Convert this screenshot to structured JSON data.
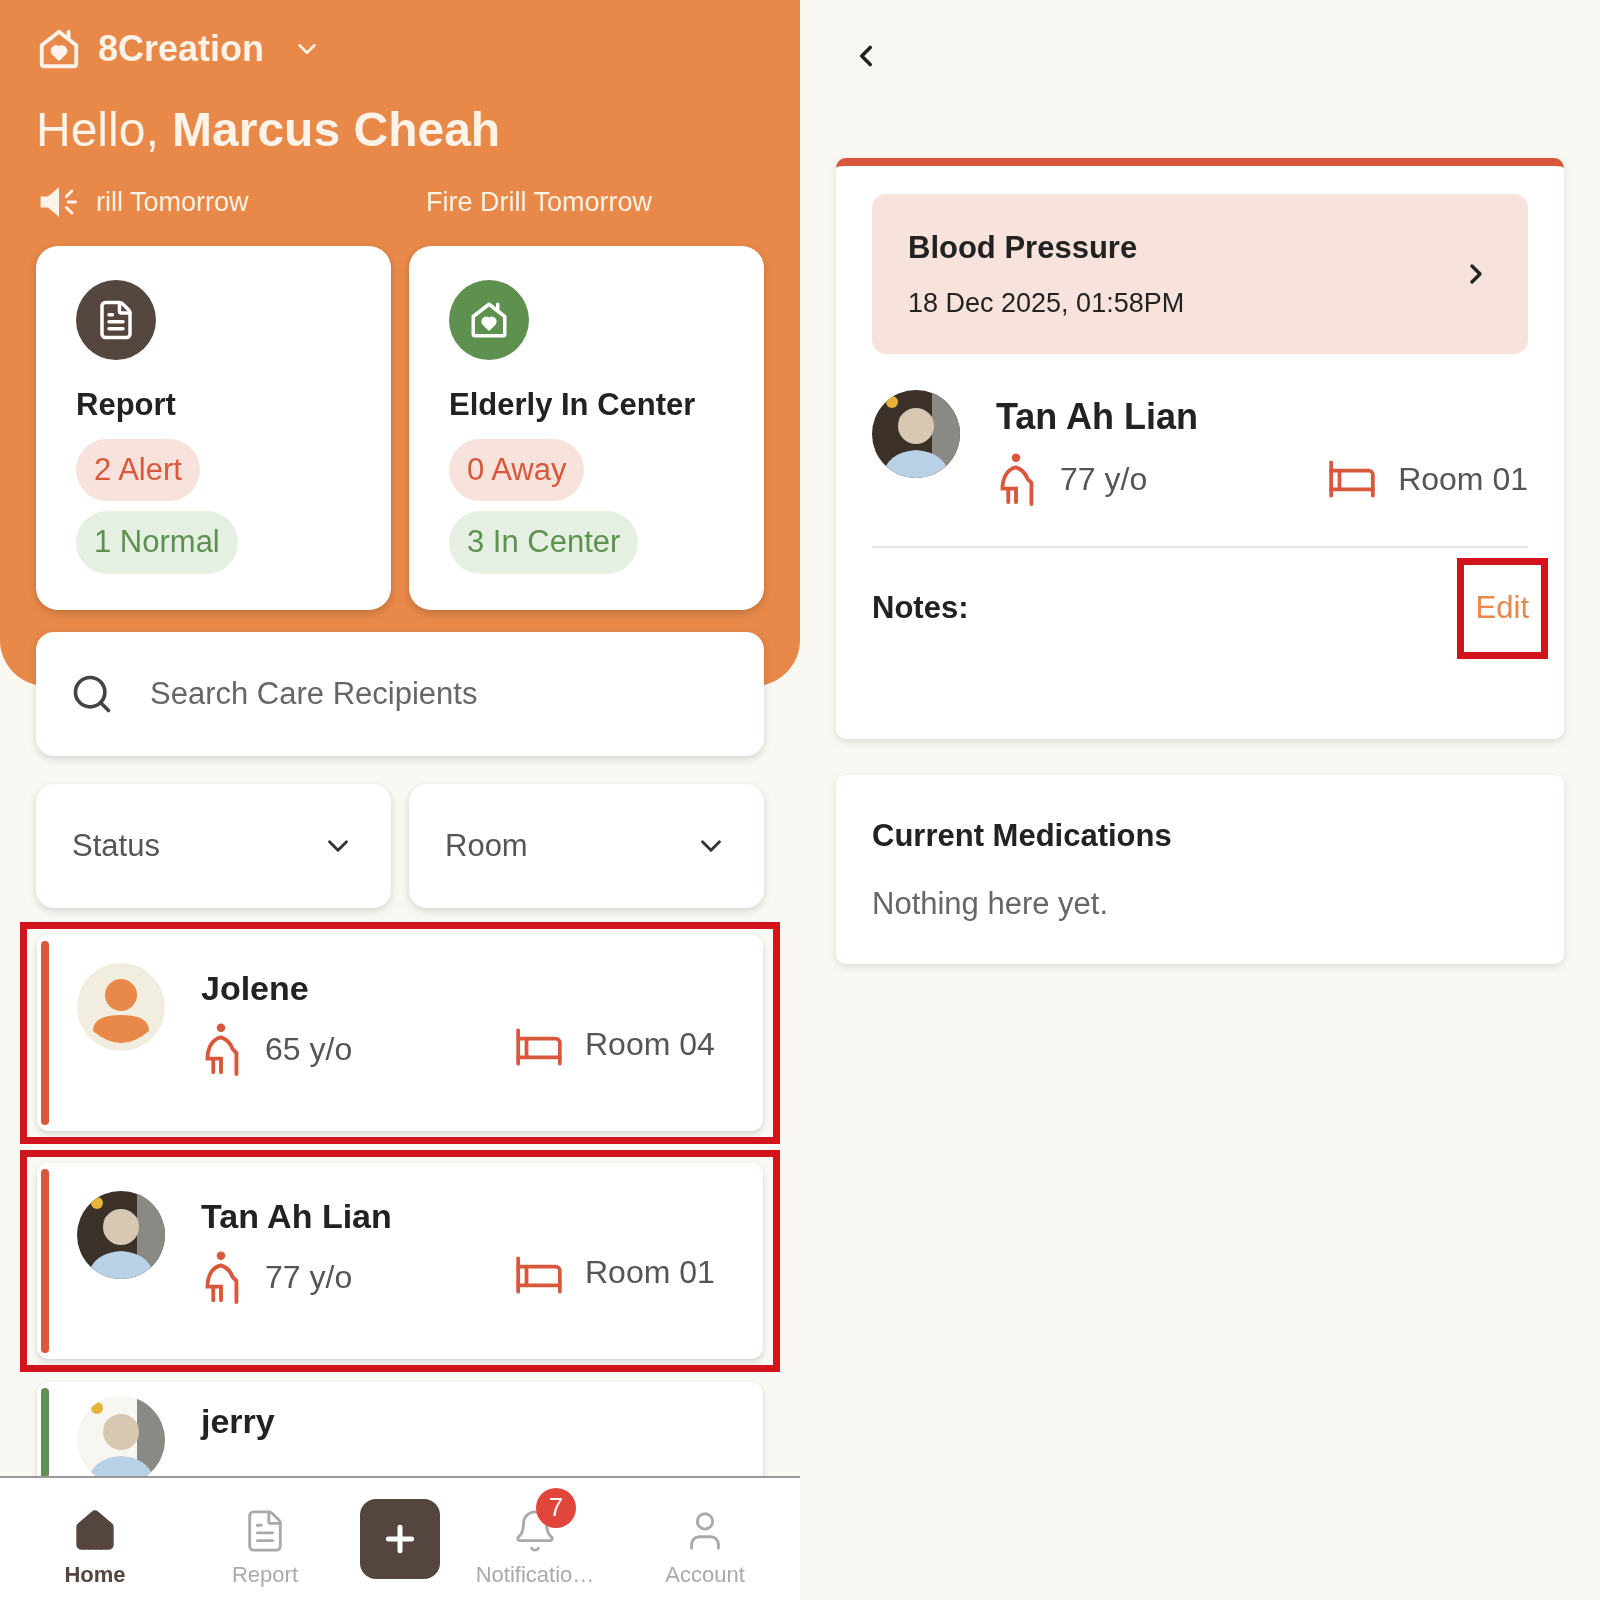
{
  "header": {
    "org": "8Creation",
    "greeting": "Hello,",
    "user": "Marcus Cheah",
    "ticker": [
      "rill Tomorrow",
      "Fire Drill Tomorrow"
    ]
  },
  "summary_cards": [
    {
      "title": "Report",
      "kind": "report",
      "badges": [
        {
          "label": "2 Alert",
          "kind": "alert"
        },
        {
          "label": "1 Normal",
          "kind": "normal"
        }
      ]
    },
    {
      "title": "Elderly In Center",
      "kind": "center",
      "badges": [
        {
          "label": "0 Away",
          "kind": "alert"
        },
        {
          "label": "3 In Center",
          "kind": "normal"
        }
      ]
    }
  ],
  "search": {
    "placeholder": "Search Care Recipients"
  },
  "filters": [
    "Status",
    "Room"
  ],
  "recipients": [
    {
      "name": "Jolene",
      "age": "65 y/o",
      "room": "Room 04",
      "kind": "placeholder",
      "color": "#d9573a",
      "highlighted": true
    },
    {
      "name": "Tan Ah Lian",
      "age": "77 y/o",
      "room": "Room 01",
      "kind": "picture",
      "color": "#d9573a",
      "highlighted": true
    },
    {
      "name": "jerry",
      "kind": "picture",
      "color": "#5e9150",
      "highlighted": false
    }
  ],
  "nav": [
    {
      "kind": "home",
      "label": "Home",
      "selected": true
    },
    {
      "kind": "report",
      "label": "Report",
      "selected": false
    },
    {
      "kind": "add",
      "selected": false
    },
    {
      "kind": "bell",
      "label": "Notificatio…",
      "badge": "7",
      "selected": false
    },
    {
      "kind": "account",
      "label": "Account",
      "selected": false
    }
  ],
  "detail": {
    "reading": {
      "title": "Blood Pressure",
      "time": "18 Dec 2025, 01:58PM"
    },
    "recipient": {
      "name": "Tan Ah Lian",
      "age": "77 y/o",
      "room": "Room 01"
    },
    "notes_label": "Notes:",
    "edit_label": "Edit",
    "edit_highlighted": true,
    "medications": {
      "title": "Current Medications",
      "empty": "Nothing here yet."
    }
  }
}
